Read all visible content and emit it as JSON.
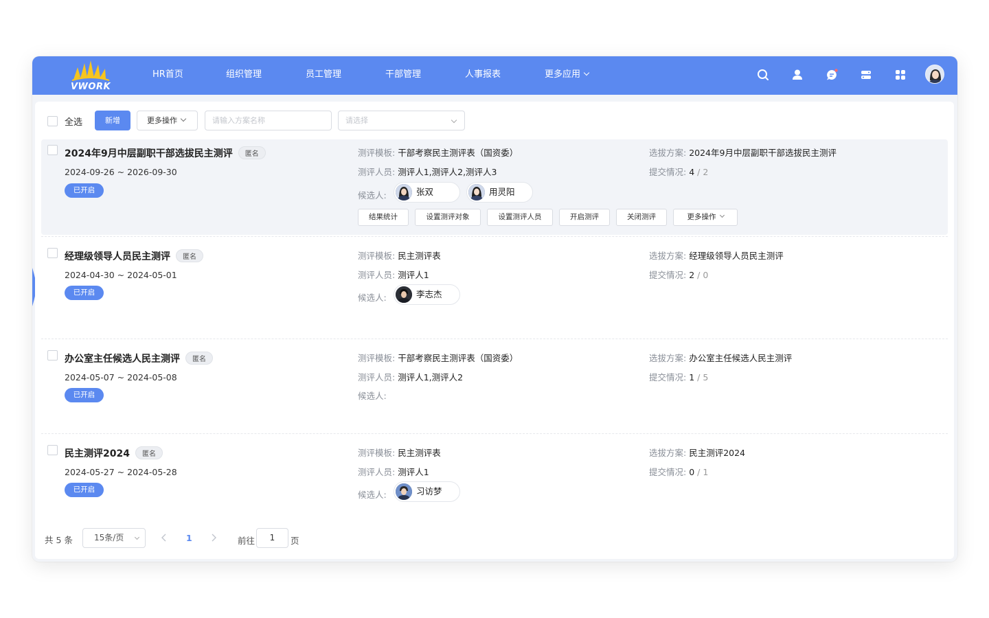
{
  "header": {
    "logo_text": "VWORK",
    "nav": [
      {
        "label": "HR首页"
      },
      {
        "label": "组织管理"
      },
      {
        "label": "员工管理"
      },
      {
        "label": "干部管理"
      },
      {
        "label": "人事报表"
      },
      {
        "label": "更多应用"
      }
    ]
  },
  "toolbar": {
    "select_all": "全选",
    "add": "新增",
    "more": "更多操作",
    "search_placeholder": "请输入方案名称",
    "select_placeholder": "请选择"
  },
  "labels": {
    "template": "测评模板:",
    "raters": "测评人员:",
    "candidates": "候选人:",
    "plan": "选拔方案:",
    "submit": "提交情况:",
    "slash": "/"
  },
  "rows": [
    {
      "title": "2024年9月中层副职干部选拔民主测评",
      "tag": "匿名",
      "date": "2024-09-26 ~ 2026-09-30",
      "status": "已开启",
      "template": "干部考察民主测评表（国资委）",
      "raters": "测评人1,测评人2,测评人3",
      "plan": "2024年9月中层副职干部选拔民主测评",
      "submitted": "4",
      "total": "2",
      "candidates": [
        "张双",
        "用灵阳"
      ],
      "actions": [
        "结果统计",
        "设置测评对象",
        "设置测评人员",
        "开启测评",
        "关闭测评",
        "更多操作"
      ]
    },
    {
      "title": "经理级领导人员民主测评",
      "tag": "匿名",
      "date": "2024-04-30 ~ 2024-05-01",
      "status": "已开启",
      "template": "民主测评表",
      "raters": "测评人1",
      "plan": "经理级领导人员民主测评",
      "submitted": "2",
      "total": "0",
      "candidates": [
        "李志杰"
      ]
    },
    {
      "title": "办公室主任候选人民主测评",
      "tag": "匿名",
      "date": "2024-05-07 ~ 2024-05-08",
      "status": "已开启",
      "template": "干部考察民主测评表（国资委）",
      "raters": "测评人1,测评人2",
      "plan": "办公室主任候选人民主测评",
      "submitted": "1",
      "total": "5",
      "candidates": []
    },
    {
      "title": "民主测评2024",
      "tag": "匿名",
      "date": "2024-05-27 ~ 2024-05-28",
      "status": "已开启",
      "template": "民主测评表",
      "raters": "测评人1",
      "plan": "民主测评2024",
      "submitted": "0",
      "total": "1",
      "candidates": [
        "习访梦"
      ]
    }
  ],
  "pagination": {
    "total_prefix": "共",
    "total_count": "5",
    "total_suffix": "条",
    "page_size": "15条/页",
    "current_page": "1",
    "goto_prefix": "前往",
    "goto_value": "1",
    "goto_suffix": "页"
  },
  "colors": {
    "primary": "#5b89f0",
    "header_bg": "#5b89f0",
    "row_active_bg": "#f2f4f8"
  }
}
